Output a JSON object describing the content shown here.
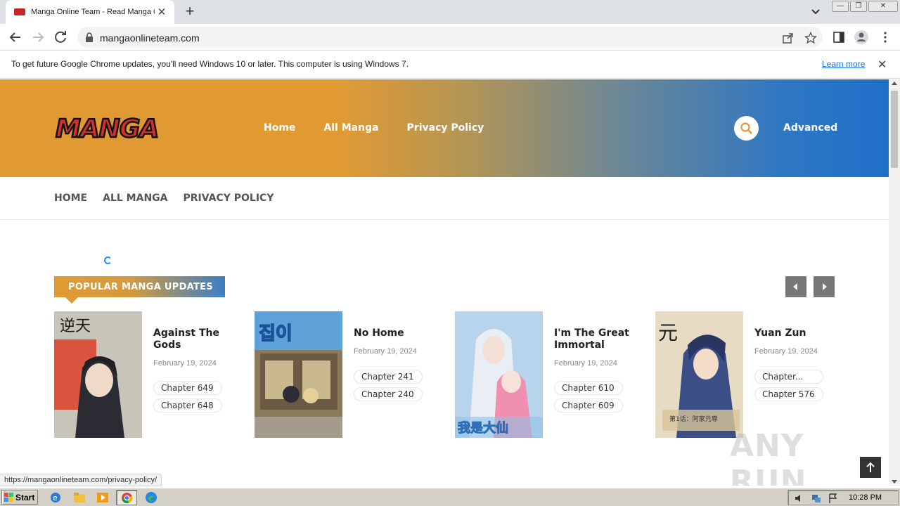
{
  "browser": {
    "tab_title": "Manga Online Team - Read Manga Online",
    "url": "mangaonlineteam.com",
    "infobar_message": "To get future Google Chrome updates, you'll need Windows 10 or later. This computer is using Windows 7.",
    "infobar_link": "Learn more",
    "status_url": "https://mangaonlineteam.com/privacy-policy/"
  },
  "site": {
    "logo_text": "MANGA",
    "main_nav": [
      "Home",
      "All Manga",
      "Privacy Policy"
    ],
    "advanced_label": "Advanced",
    "sub_nav": [
      "HOME",
      "ALL MANGA",
      "PRIVACY POLICY"
    ],
    "section_title": "POPULAR MANGA UPDATES",
    "watermark": "ANY RUN",
    "manga": [
      {
        "title": "Against The Gods",
        "date": "February 19, 2024",
        "chapters": [
          "Chapter 649",
          "Chapter 648"
        ]
      },
      {
        "title": "No Home",
        "date": "February 19, 2024",
        "chapters": [
          "Chapter 241",
          "Chapter 240"
        ]
      },
      {
        "title": "I'm The Great Immortal",
        "date": "February 19, 2024",
        "chapters": [
          "Chapter 610",
          "Chapter 609"
        ]
      },
      {
        "title": "Yuan Zun",
        "date": "February 19, 2024",
        "chapters": [
          "Chapter...",
          "Chapter 576"
        ]
      }
    ]
  },
  "taskbar": {
    "start_label": "Start",
    "clock": "10:28 PM"
  },
  "colors": {
    "header_orange": "#e19a33",
    "header_blue": "#1f6fc8",
    "link_blue": "#1a73e8"
  }
}
